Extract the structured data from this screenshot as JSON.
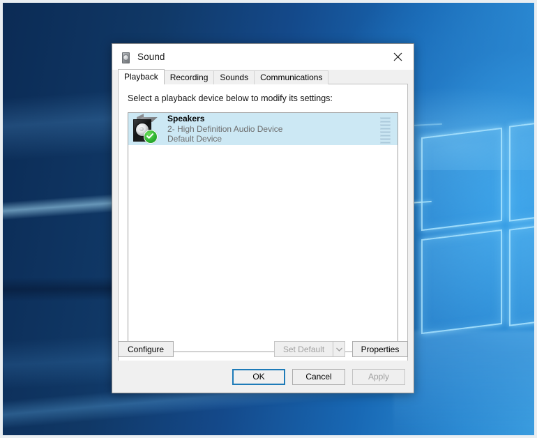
{
  "desktop": {
    "wallpaper_name": "windows-10-hero-wallpaper",
    "colors": {
      "deep_navy": "#0b2b55",
      "mid_blue": "#14498a",
      "bright_blue": "#3ba0e2",
      "logo_glow": "#afe6ff"
    }
  },
  "dialog": {
    "title": "Sound",
    "title_icon": "speaker-icon",
    "close_icon": "close-icon",
    "tabs": [
      {
        "label": "Playback",
        "active": true
      },
      {
        "label": "Recording",
        "active": false
      },
      {
        "label": "Sounds",
        "active": false
      },
      {
        "label": "Communications",
        "active": false
      }
    ],
    "playback": {
      "instruction": "Select a playback device below to modify its settings:",
      "devices": [
        {
          "name": "Speakers",
          "driver": "2- High Definition Audio Device",
          "status": "Default Device",
          "icon": "speaker-device-icon",
          "badge": "green-check-icon",
          "selected": true,
          "meter_segments": 8,
          "meter_level": 0
        }
      ],
      "buttons": {
        "configure": "Configure",
        "set_default": "Set Default",
        "set_default_arrow": "chevron-down-icon",
        "set_default_disabled": true,
        "properties": "Properties"
      }
    },
    "footer": {
      "ok": "OK",
      "cancel": "Cancel",
      "apply": "Apply",
      "apply_disabled": true,
      "default_button": "OK",
      "focus_color": "#1e7bb8"
    }
  }
}
